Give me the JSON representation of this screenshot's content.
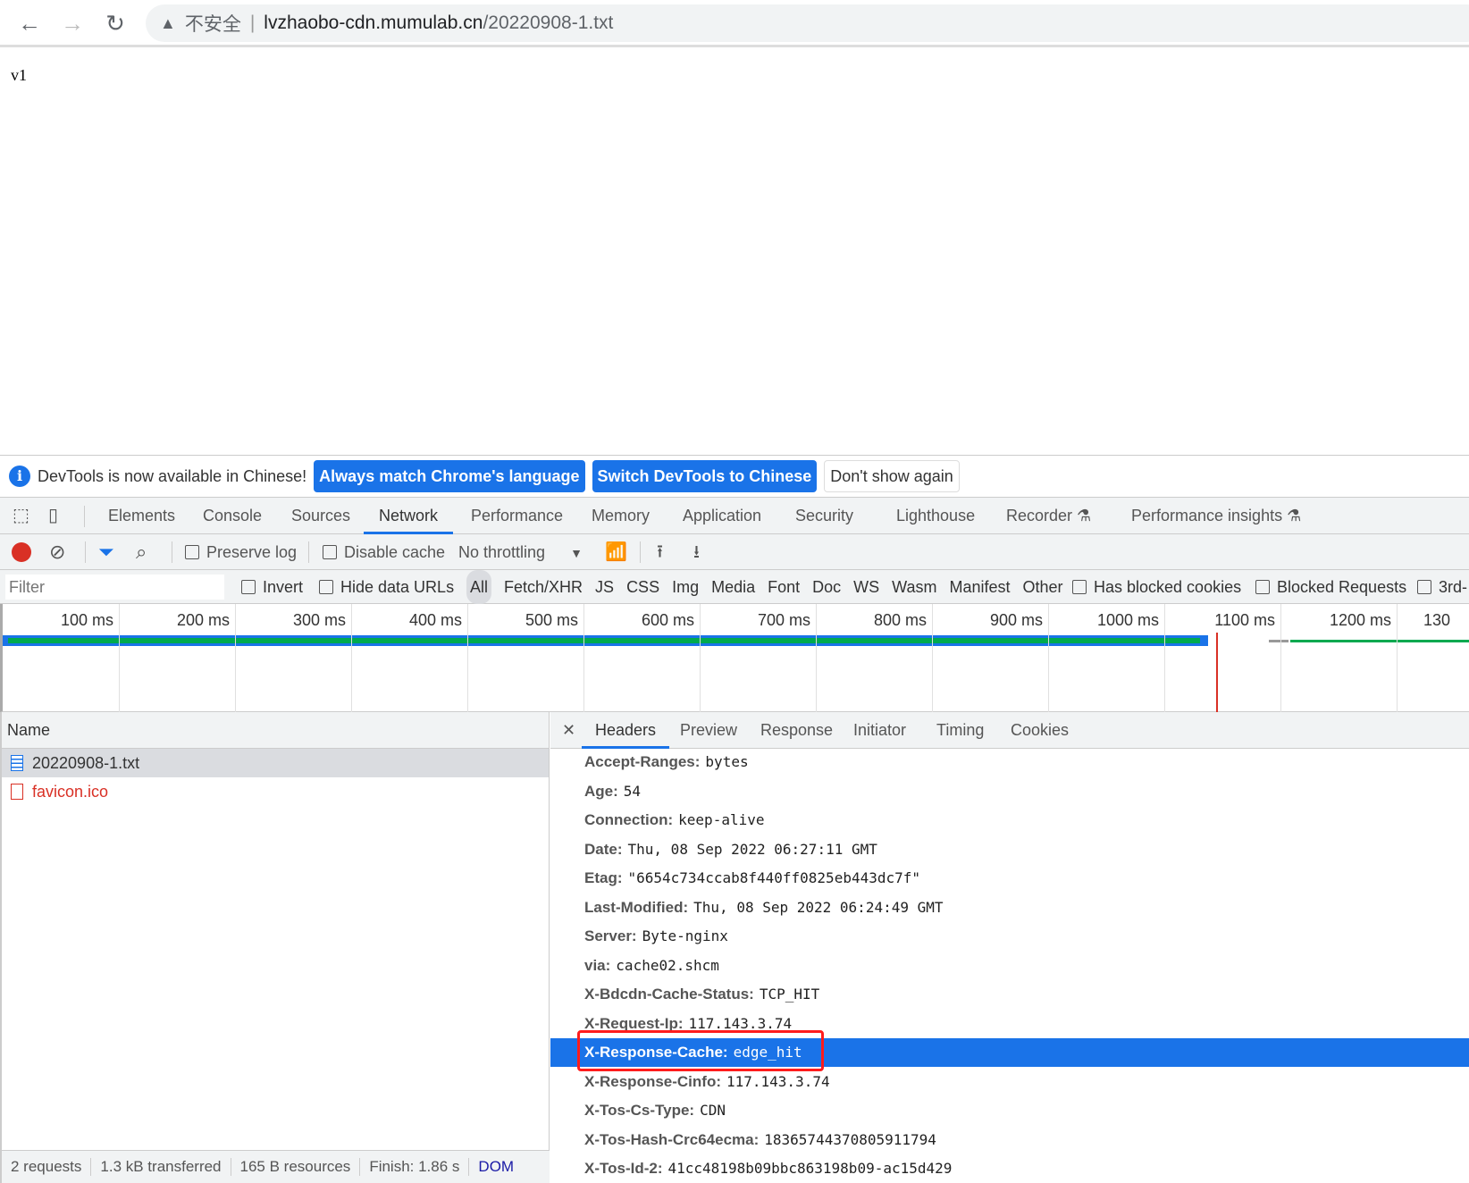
{
  "browser": {
    "url_warning": "不安全",
    "url_host": "lvzhaobo-cdn.mumulab.cn",
    "url_path": "/20220908-1.txt"
  },
  "page": {
    "content": "v1"
  },
  "infobar": {
    "message": "DevTools is now available in Chinese!",
    "btn_match": "Always match Chrome's language",
    "btn_switch": "Switch DevTools to Chinese",
    "btn_dismiss": "Don't show again"
  },
  "tabs": [
    "Elements",
    "Console",
    "Sources",
    "Network",
    "Performance",
    "Memory",
    "Application",
    "Security",
    "Lighthouse",
    "Recorder",
    "Performance insights"
  ],
  "active_tab": "Network",
  "toolbar": {
    "preserve_log": "Preserve log",
    "disable_cache": "Disable cache",
    "throttling": "No throttling"
  },
  "filters": {
    "placeholder": "Filter",
    "invert": "Invert",
    "hide_data_urls": "Hide data URLs",
    "types": [
      "All",
      "Fetch/XHR",
      "JS",
      "CSS",
      "Img",
      "Media",
      "Font",
      "Doc",
      "WS",
      "Wasm",
      "Manifest",
      "Other"
    ],
    "has_blocked_cookies": "Has blocked cookies",
    "blocked_requests": "Blocked Requests",
    "third_party": "3rd-"
  },
  "timeline": {
    "ticks": [
      "100 ms",
      "200 ms",
      "300 ms",
      "400 ms",
      "500 ms",
      "600 ms",
      "700 ms",
      "800 ms",
      "900 ms",
      "1000 ms",
      "1100 ms",
      "1200 ms",
      "130"
    ]
  },
  "requests": {
    "header": "Name",
    "items": [
      {
        "name": "20220908-1.txt",
        "error": false
      },
      {
        "name": "favicon.ico",
        "error": true
      }
    ]
  },
  "status": {
    "requests": "2 requests",
    "transferred": "1.3 kB transferred",
    "resources": "165 B resources",
    "finish": "Finish: 1.86 s",
    "dom": "DOM"
  },
  "details": {
    "tabs": [
      "Headers",
      "Preview",
      "Response",
      "Initiator",
      "Timing",
      "Cookies"
    ],
    "active": "Headers",
    "headers": [
      {
        "k": "Accept-Ranges:",
        "v": "bytes"
      },
      {
        "k": "Age:",
        "v": "54"
      },
      {
        "k": "Connection:",
        "v": "keep-alive"
      },
      {
        "k": "Date:",
        "v": "Thu, 08 Sep 2022 06:27:11 GMT"
      },
      {
        "k": "Etag:",
        "v": "\"6654c734ccab8f440ff0825eb443dc7f\""
      },
      {
        "k": "Last-Modified:",
        "v": "Thu, 08 Sep 2022 06:24:49 GMT"
      },
      {
        "k": "Server:",
        "v": "Byte-nginx"
      },
      {
        "k": "via:",
        "v": "cache02.shcm"
      },
      {
        "k": "X-Bdcdn-Cache-Status:",
        "v": "TCP_HIT"
      },
      {
        "k": "X-Request-Ip:",
        "v": "117.143.3.74"
      },
      {
        "k": "X-Response-Cache:",
        "v": "edge_hit",
        "selected": true
      },
      {
        "k": "X-Response-Cinfo:",
        "v": "117.143.3.74"
      },
      {
        "k": "X-Tos-Cs-Type:",
        "v": "CDN"
      },
      {
        "k": "X-Tos-Hash-Crc64ecma:",
        "v": "18365744370805911794"
      },
      {
        "k": "X-Tos-Id-2:",
        "v": "41cc48198b09bbc863198b09-ac15d429"
      }
    ]
  },
  "colors": {
    "accent": "#1a73e8",
    "highlight_box": "#ff1c1c",
    "waterfall_green": "#00a94f",
    "load_line": "#d93025"
  }
}
